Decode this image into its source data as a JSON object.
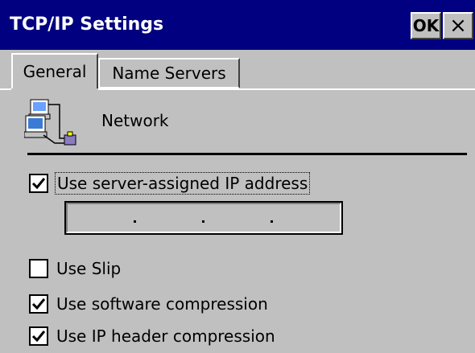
{
  "window": {
    "title": "TCP/IP Settings",
    "ok_label": "OK",
    "close_label": "×",
    "colors": {
      "titlebar": "#000080",
      "face": "#c0c0c0"
    }
  },
  "tabs": [
    {
      "label": "General",
      "active": true
    },
    {
      "label": "Name Servers",
      "active": false
    }
  ],
  "section": {
    "icon": "network-computers-icon",
    "label": "Network"
  },
  "options": {
    "server_assigned_ip": {
      "label": "Use server-assigned IP address",
      "checked": true
    },
    "ip_address": {
      "octets": [
        "",
        "",
        "",
        ""
      ]
    },
    "use_slip": {
      "label": "Use Slip",
      "checked": false
    },
    "software_compression": {
      "label": "Use software compression",
      "checked": true
    },
    "ip_header_compression": {
      "label": "Use IP header compression",
      "checked": true
    }
  }
}
